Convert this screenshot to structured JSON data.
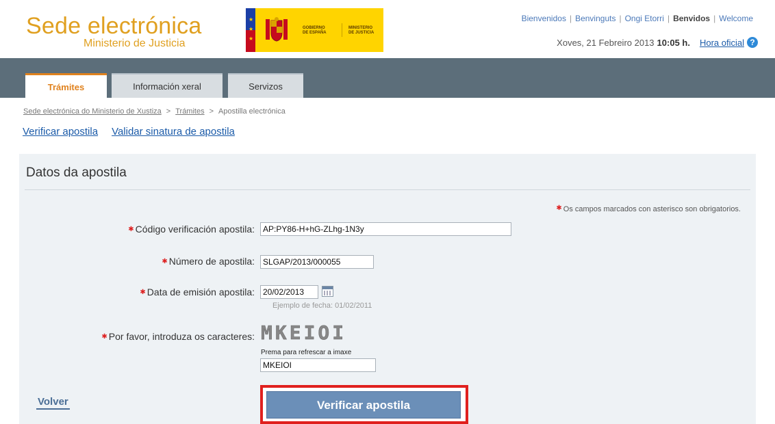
{
  "header": {
    "brand_title": "Sede electrónica",
    "brand_subtitle": "Ministerio de Justicia",
    "gov_line1": "GOBIERNO",
    "gov_line2": "DE ESPAÑA",
    "min_line1": "MINISTERIO",
    "min_line2": "DE JUSTICIA",
    "languages": [
      "Bienvenidos",
      "Benvinguts",
      "Ongi Etorri",
      "Benvidos",
      "Welcome"
    ],
    "date_text": "Xoves, 21 Febreiro 2013",
    "time_text": "10:05 h.",
    "official_time_link": "Hora oficial"
  },
  "nav": {
    "tabs": [
      {
        "label": "Trámites",
        "active": true
      },
      {
        "label": "Información xeral",
        "active": false
      },
      {
        "label": "Servizos",
        "active": false
      }
    ]
  },
  "breadcrumb": {
    "items": [
      "Sede electrónica do Ministerio de Xustiza",
      "Trámites",
      "Apostilla electrónica"
    ]
  },
  "sublinks": [
    "Verificar apostila",
    "Validar sinatura de apostila"
  ],
  "form": {
    "title": "Datos da apostila",
    "required_note": "Os campos marcados con asterisco son obrigatorios.",
    "code_label": "Código verificación apostila:",
    "code_value": "AP:PY86-H+hG-ZLhg-1N3y",
    "number_label": "Número de apostila:",
    "number_value": "SLGAP/2013/000055",
    "date_label": "Data de emisión apostila:",
    "date_value": "20/02/2013",
    "date_hint": "Ejemplo de fecha: 01/02/2011",
    "captcha_label": "Por favor, introduza os caracteres:",
    "captcha_image_text": "MKEIOI",
    "refresh_text": "Prema para refrescar a imaxe",
    "captcha_value": "MKEIOI"
  },
  "actions": {
    "back_label": "Volver",
    "verify_label": "Verificar apostila"
  },
  "colors": {
    "brand": "#e0a020",
    "nav_bar": "#5c6e7a",
    "active_tab": "#e0821e",
    "button": "#6b8fb8",
    "highlight": "#e0201e",
    "link": "#1a5aa8"
  }
}
